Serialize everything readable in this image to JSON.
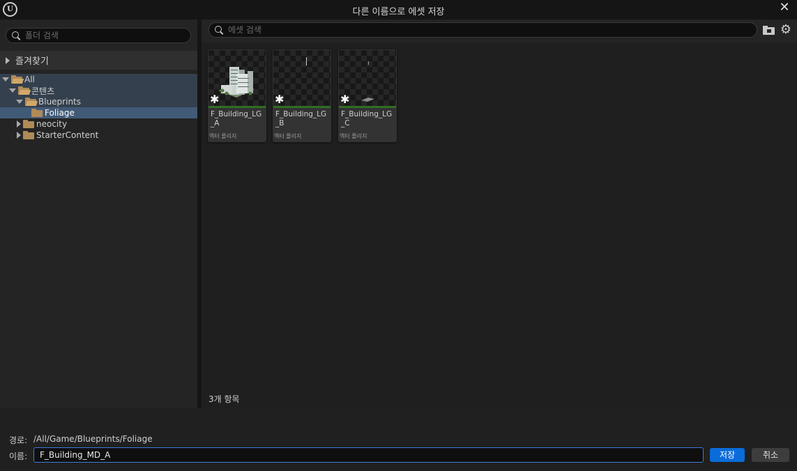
{
  "window": {
    "title": "다른 이름으로 에셋 저장",
    "close_glyph": "✕"
  },
  "left_panel": {
    "search_placeholder": "폴더 검색",
    "favorites_label": "즐겨찾기",
    "tree": [
      {
        "label": "All",
        "expanded": true
      },
      {
        "label": "콘텐츠",
        "expanded": true
      },
      {
        "label": "Blueprints",
        "expanded": true
      },
      {
        "label": "Foliage",
        "selected": true
      },
      {
        "label": "neocity",
        "expanded": false
      },
      {
        "label": "StarterContent",
        "expanded": false
      }
    ]
  },
  "right_panel": {
    "search_placeholder": "에셋 검색",
    "assets": [
      {
        "name": "F_Building_LG_A",
        "type": "액터 폴리지"
      },
      {
        "name": "F_Building_LG_B",
        "type": "액터 폴리지"
      },
      {
        "name": "F_Building_LG_C",
        "type": "액터 폴리지"
      }
    ],
    "item_count": "3개 항목"
  },
  "footer": {
    "path_label": "경로:",
    "path_value": "/All/Game/Blueprints/Foliage",
    "name_label": "이름:",
    "name_value": "F_Building_MD_A",
    "save_label": "저장",
    "cancel_label": "취소"
  },
  "colors": {
    "accent": "#0a6cda",
    "selection": "#415a76",
    "folder": "#b08b57"
  }
}
